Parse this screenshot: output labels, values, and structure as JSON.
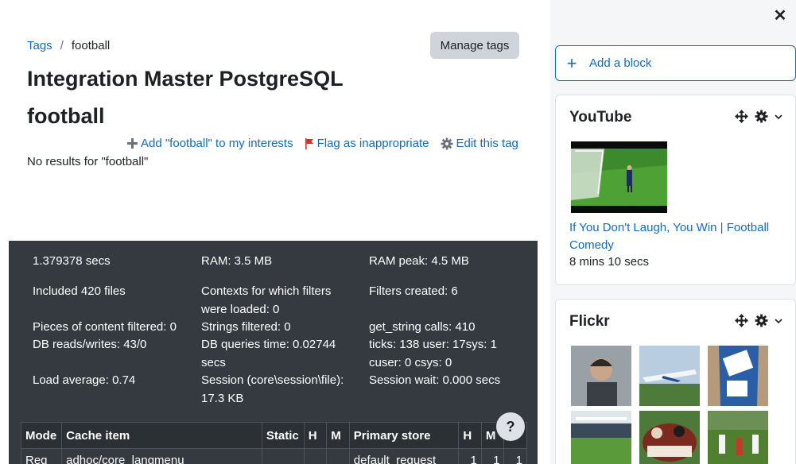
{
  "breadcrumb": {
    "parent": "Tags",
    "separator": "/",
    "current": "football"
  },
  "manage_tags_label": "Manage tags",
  "site_title": "Integration Master PostgreSQL",
  "tag_title": "football",
  "tag_actions": {
    "add_interest": "Add \"football\" to my interests",
    "flag": "Flag as inappropriate",
    "edit": "Edit this tag"
  },
  "no_results": "No results for \"football\"",
  "perf": {
    "time": "1.379378 secs",
    "ram": "RAM: 3.5 MB",
    "ram_peak": "RAM peak: 4.5 MB",
    "included": "Included 420 files",
    "contexts": "Contexts for which filters were loaded: 0",
    "filters_created": "Filters created: 6",
    "pieces": "Pieces of content filtered: 0",
    "strings": "Strings filtered: 0",
    "get_string": "get_string calls: 410",
    "db_rw": "DB reads/writes: 43/0",
    "db_time": "DB queries time: 0.02744 secs",
    "ticks": "ticks: 138 user: 17sys: 1 cuser: 0 csys: 0",
    "load": "Load average: 0.74",
    "session": "Session (core\\session\\file): 17.3 KB",
    "session_wait": "Session wait: 0.000 secs"
  },
  "cache_table": {
    "headers": [
      "Mode",
      "Cache item",
      "Static",
      "H",
      "M",
      "Primary store",
      "H",
      "M",
      "S"
    ],
    "rows": [
      [
        "Req",
        "adhoc/core_langmenu",
        "",
        "",
        "",
        "default_request",
        "1",
        "1",
        "1"
      ]
    ]
  },
  "help_label": "?",
  "drawer": {
    "close_label": "✕",
    "add_block_plus": "+",
    "add_block_label": "Add a block",
    "youtube": {
      "title": "YouTube",
      "video_title": "If You Don't Laugh, You Win | Football Comedy",
      "duration": "8 mins 10 secs"
    },
    "flickr": {
      "title": "Flickr"
    }
  },
  "colors": {
    "link": "#0f6cbf",
    "footer_bg": "#343a40",
    "drawer_bg": "#f5f6f7"
  }
}
